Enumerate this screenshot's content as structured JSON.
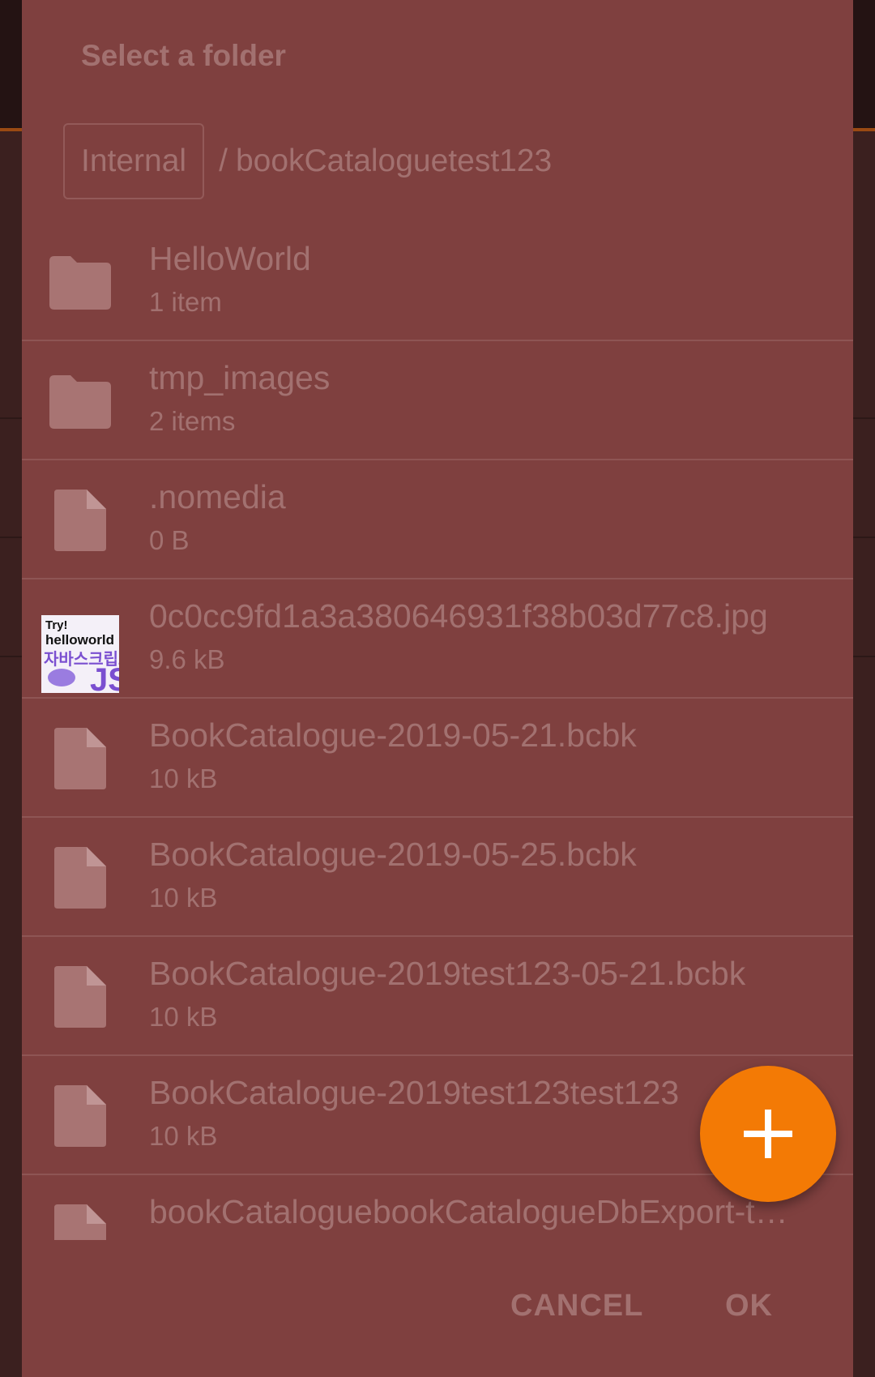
{
  "dialog": {
    "title": "Select a folder",
    "breadcrumb": {
      "root": "Internal",
      "separator": "/",
      "path": "bookCataloguetest123"
    },
    "items": [
      {
        "name": "HelloWorld",
        "meta": "1 item",
        "icon": "folder-icon"
      },
      {
        "name": "tmp_images",
        "meta": "2 items",
        "icon": "folder-icon"
      },
      {
        "name": ".nomedia",
        "meta": "0 B",
        "icon": "file-icon"
      },
      {
        "name": "0c0cc9fd1a3a380646931f38b03d77c8.jpg",
        "meta": "9.6 kB",
        "icon": "image-thumbnail"
      },
      {
        "name": "BookCatalogue-2019-05-21.bcbk",
        "meta": "10 kB",
        "icon": "file-icon"
      },
      {
        "name": "BookCatalogue-2019-05-25.bcbk",
        "meta": "10 kB",
        "icon": "file-icon"
      },
      {
        "name": "BookCatalogue-2019test123-05-21.bcbk",
        "meta": "10 kB",
        "icon": "file-icon"
      },
      {
        "name": "BookCatalogue-2019test123test123",
        "meta": "10 kB",
        "icon": "file-icon"
      },
      {
        "name": "bookCataloguebookCatalogueDbExport-t…",
        "meta": "",
        "icon": "file-icon"
      }
    ],
    "thumbnail": {
      "line1": "Try!",
      "line2": "helloworld",
      "line3": "자바스크립트",
      "badge": "JS"
    },
    "actions": {
      "cancel": "CANCEL",
      "ok": "OK"
    },
    "fab": {
      "icon": "plus-icon",
      "color": "#f37a05"
    }
  },
  "colors": {
    "dialog_bg": "#7f403f",
    "text": "#a27170",
    "divider": "#8e5554",
    "accent": "#f37a05"
  }
}
